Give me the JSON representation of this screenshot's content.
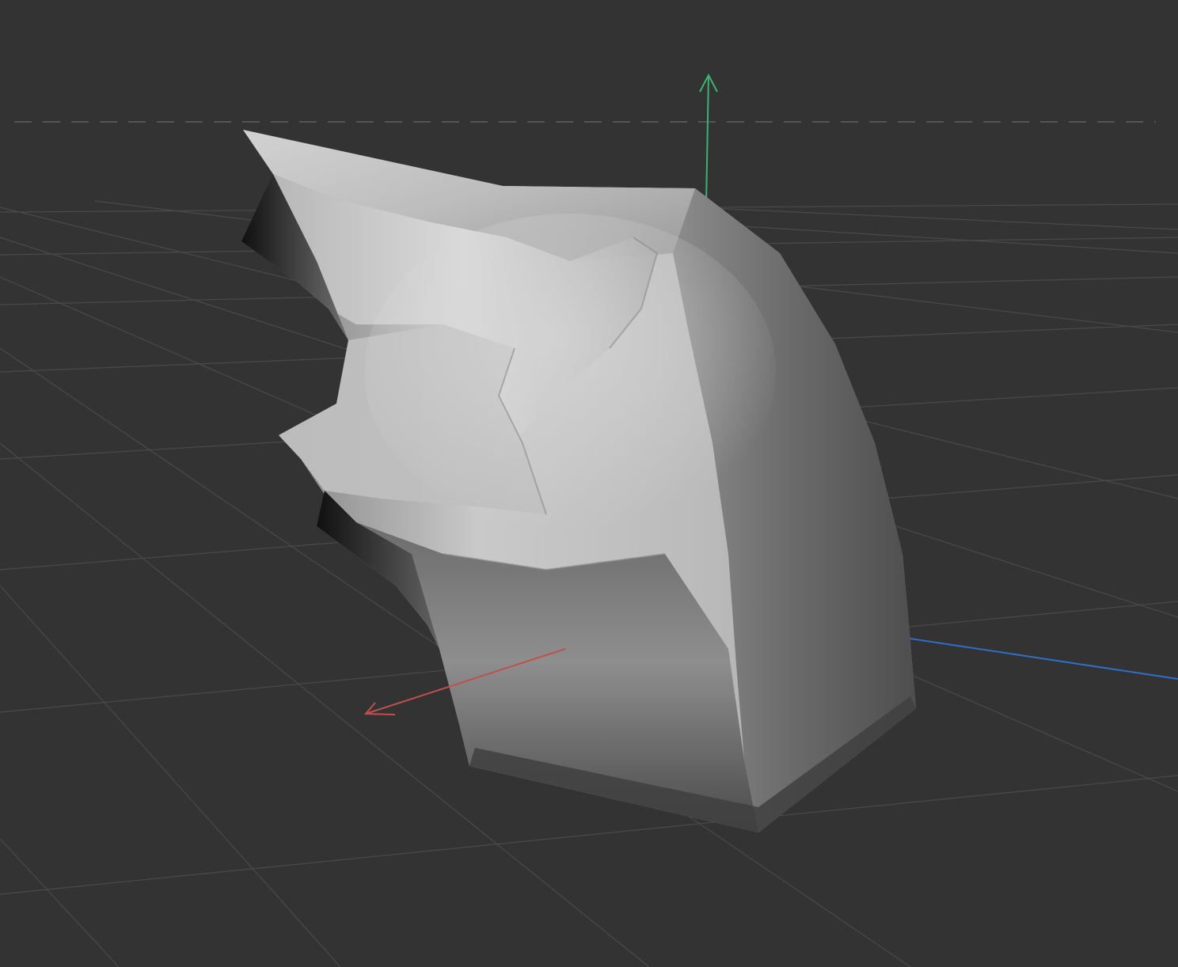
{
  "viewport": {
    "background": "#333333",
    "grid_color": "#4a4a4a",
    "horizon_color": "#555555",
    "horizon_style": "dashed"
  },
  "axes": {
    "x": {
      "color": "#c0504d"
    },
    "y": {
      "color": "#3cb371"
    },
    "z": {
      "color": "#2f6fc9"
    }
  },
  "mesh": {
    "shading": "smooth-gray",
    "base_color": "#a8a8a8"
  }
}
